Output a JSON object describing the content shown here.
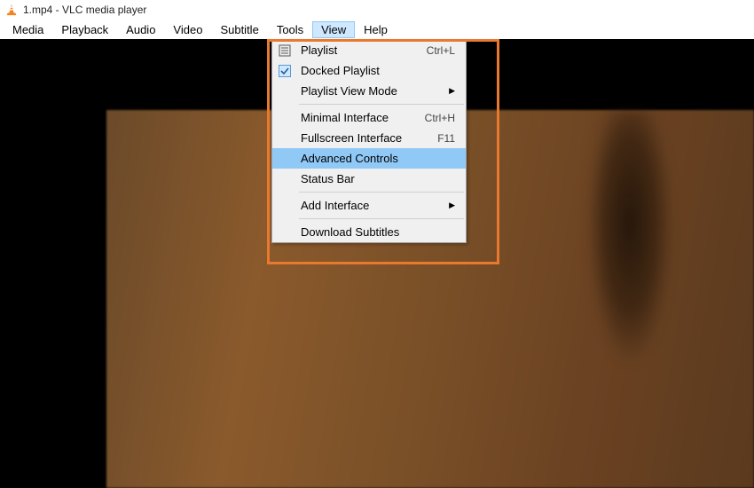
{
  "window": {
    "title": "1.mp4 - VLC media player"
  },
  "menubar": {
    "items": [
      "Media",
      "Playback",
      "Audio",
      "Video",
      "Subtitle",
      "Tools",
      "View",
      "Help"
    ],
    "active_index": 6
  },
  "dropdown": {
    "items": [
      {
        "icon": "playlist",
        "label": "Playlist",
        "shortcut": "Ctrl+L"
      },
      {
        "icon": "checked",
        "label": "Docked Playlist"
      },
      {
        "label": "Playlist View Mode",
        "submenu": true
      },
      {
        "sep": true
      },
      {
        "label": "Minimal Interface",
        "shortcut": "Ctrl+H"
      },
      {
        "label": "Fullscreen Interface",
        "shortcut": "F11"
      },
      {
        "label": "Advanced Controls",
        "highlight": true
      },
      {
        "label": "Status Bar"
      },
      {
        "sep": true
      },
      {
        "label": "Add Interface",
        "submenu": true
      },
      {
        "sep": true
      },
      {
        "label": "Download Subtitles"
      }
    ]
  }
}
